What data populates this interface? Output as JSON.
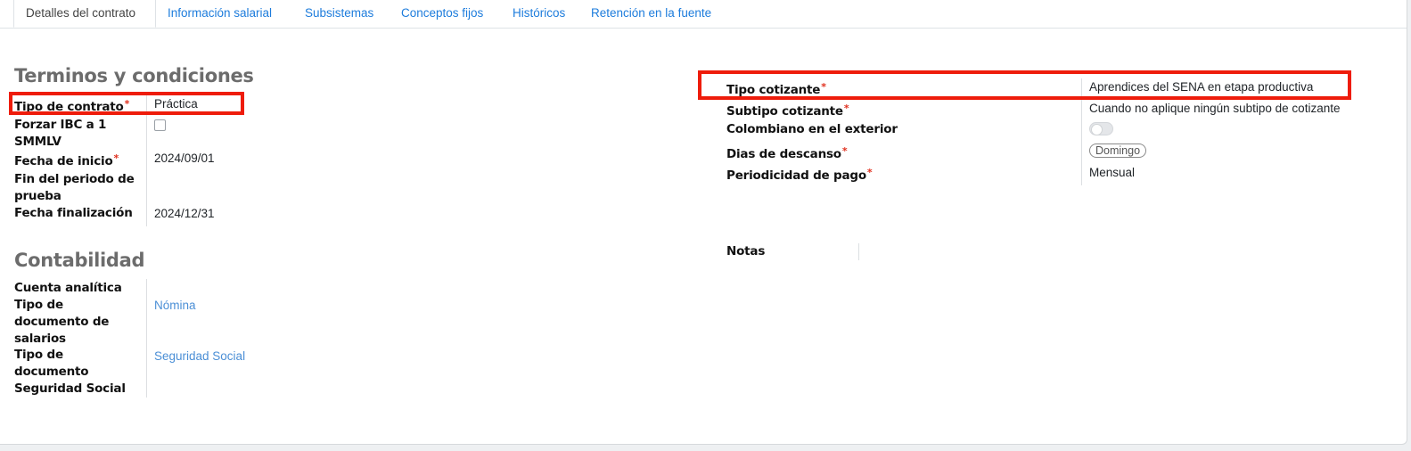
{
  "tabs": [
    {
      "label": "Detalles del contrato"
    },
    {
      "label": "Información salarial"
    },
    {
      "label": "Subsistemas"
    },
    {
      "label": "Conceptos fijos"
    },
    {
      "label": "Históricos"
    },
    {
      "label": "Retención en la fuente"
    }
  ],
  "terms": {
    "title": "Terminos y condiciones",
    "tipo_contrato": {
      "label": "Tipo de contrato",
      "value": "Práctica"
    },
    "forzar_ibc": {
      "label_1": "Forzar IBC a 1",
      "label_2": "SMMLV",
      "checked": false
    },
    "fecha_inicio": {
      "label": "Fecha de inicio",
      "value": "2024/09/01"
    },
    "fin_prueba": {
      "label_1": "Fin del periodo de",
      "label_2": "prueba",
      "value": ""
    },
    "fecha_finalizacion": {
      "label": "Fecha finalización",
      "value": "2024/12/31"
    }
  },
  "accounting": {
    "title": "Contabilidad",
    "cuenta_analitica": {
      "label": "Cuenta analítica",
      "value": ""
    },
    "tipo_doc_salarios": {
      "label_1": "Tipo de",
      "label_2": "documento de",
      "label_3": "salarios",
      "value": "Nómina"
    },
    "tipo_doc_seguridad": {
      "label_1": "Tipo de",
      "label_2": "documento",
      "label_3": "Seguridad Social",
      "value": "Seguridad Social"
    }
  },
  "right": {
    "tipo_cotizante": {
      "label": "Tipo cotizante",
      "value": "Aprendices del SENA en etapa productiva"
    },
    "subtipo_cotizante": {
      "label": "Subtipo cotizante",
      "value": "Cuando no aplique ningún subtipo de cotizante"
    },
    "colombiano_exterior": {
      "label": "Colombiano en el exterior",
      "enabled": false
    },
    "dias_descanso": {
      "label": "Dias de descanso",
      "value": "Domingo"
    },
    "periodicidad_pago": {
      "label": "Periodicidad de pago",
      "value": "Mensual"
    },
    "notas": {
      "label": "Notas",
      "value": ""
    }
  },
  "required_mark": "*",
  "highlight_color": "#ee1c0b"
}
